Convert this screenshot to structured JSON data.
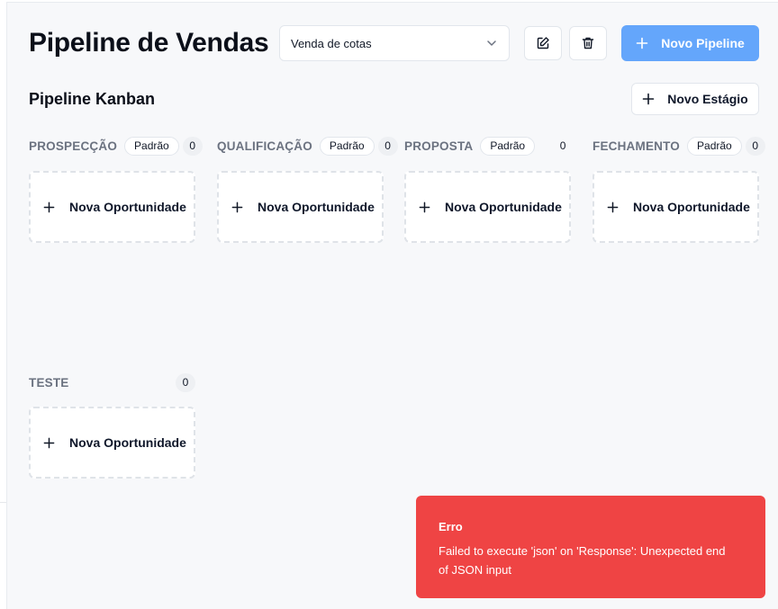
{
  "header": {
    "title": "Pipeline de Vendas",
    "pipeline_select": {
      "value": "Venda de cotas"
    },
    "new_pipeline_label": "Novo Pipeline"
  },
  "board": {
    "title": "Pipeline Kanban",
    "new_stage_label": "Novo Estágio",
    "default_badge": "Padrão",
    "add_card_label": "Nova Oportunidade",
    "stages": [
      {
        "name": "PROSPECÇÃO",
        "default": true,
        "count": "0"
      },
      {
        "name": "QUALIFICAÇÃO",
        "default": true,
        "count": "0"
      },
      {
        "name": "PROPOSTA",
        "default": true,
        "count": "0"
      },
      {
        "name": "FECHAMENTO",
        "default": true,
        "count": "0"
      },
      {
        "name": "TESTE",
        "default": false,
        "count": "0"
      }
    ]
  },
  "toast": {
    "title": "Erro",
    "message": "Failed to execute 'json' on 'Response': Unexpected end of JSON input",
    "color": "#ef4444"
  },
  "colors": {
    "primary_button": "#64a6fb",
    "background": "#f7f8fa"
  },
  "icons": {
    "edit": "edit-icon",
    "delete": "trash-icon",
    "add": "plus-icon",
    "select": "chevron-down-icon"
  }
}
